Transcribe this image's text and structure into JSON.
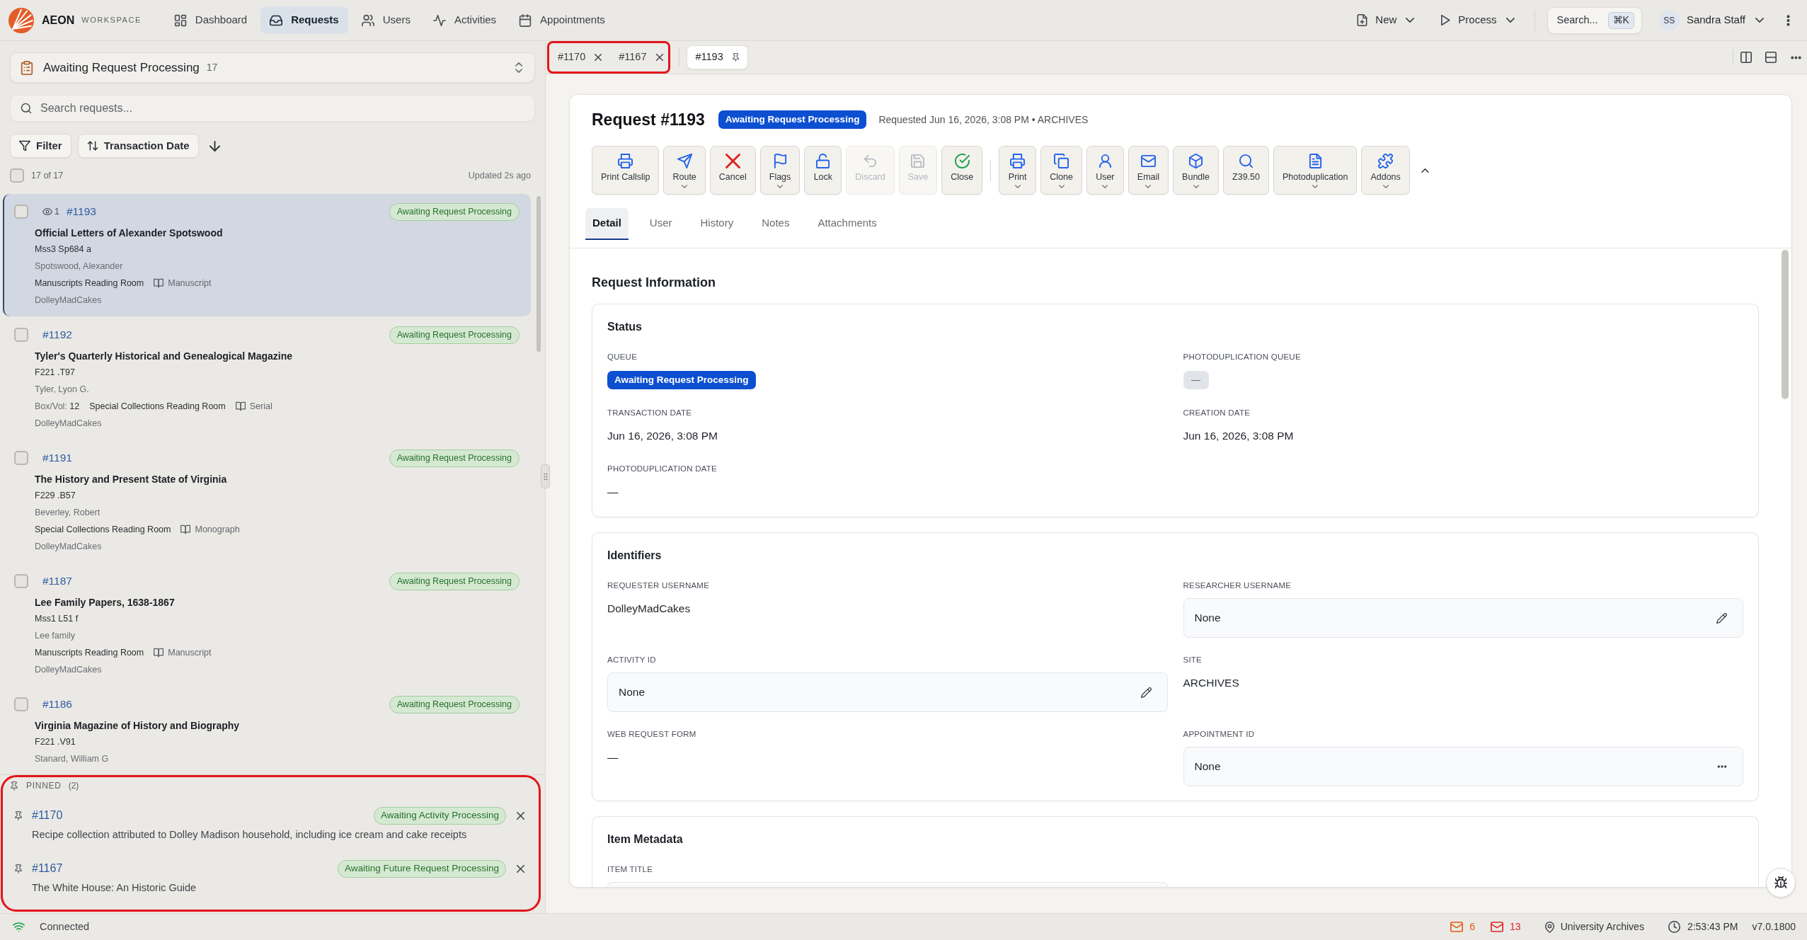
{
  "brand": {
    "name": "AEON",
    "subtitle": "WORKSPACE"
  },
  "nav": [
    {
      "label": "Dashboard",
      "selected": false
    },
    {
      "label": "Requests",
      "selected": true
    },
    {
      "label": "Users",
      "selected": false
    },
    {
      "label": "Activities",
      "selected": false
    },
    {
      "label": "Appointments",
      "selected": false
    }
  ],
  "header_actions": [
    {
      "label": "New"
    },
    {
      "label": "Process"
    }
  ],
  "global_search": {
    "placeholder": "Search...",
    "shortcut": "⌘K"
  },
  "user_menu": {
    "initials": "SS",
    "name": "Sandra Staff"
  },
  "queue_selector": {
    "label": "Awaiting Request Processing",
    "count": "17"
  },
  "request_search": {
    "placeholder": "Search requests..."
  },
  "filter_button": {
    "label": "Filter"
  },
  "sort_button": {
    "label": "Transaction Date"
  },
  "list_summary": {
    "checked": false,
    "count": "17 of 17",
    "updated": "Updated 2s ago"
  },
  "requests": [
    {
      "id": "#1193",
      "views": "1",
      "title": "Official Letters of Alexander Spotswood",
      "call_number": "Mss3 Sp684 a",
      "author": "Spotswood, Alexander",
      "location": "Manuscripts Reading Room",
      "format": "Manuscript",
      "user": "DolleyMadCakes",
      "status": "Awaiting Request Processing",
      "selected": true,
      "checked": false
    },
    {
      "id": "#1192",
      "title": "Tyler's Quarterly Historical and Genealogical Magazine",
      "call_number": "F221 .T97",
      "author": "Tyler, Lyon G.",
      "box_vol_label": "Box/Vol:",
      "box_vol": "12",
      "location": "Special Collections Reading Room",
      "format": "Serial",
      "user": "DolleyMadCakes",
      "status": "Awaiting Request Processing",
      "selected": false,
      "checked": false
    },
    {
      "id": "#1191",
      "title": "The History and Present State of Virginia",
      "call_number": "F229 .B57",
      "author": "Beverley, Robert",
      "location": "Special Collections Reading Room",
      "format": "Monograph",
      "user": "DolleyMadCakes",
      "status": "Awaiting Request Processing",
      "selected": false,
      "checked": false
    },
    {
      "id": "#1187",
      "title": "Lee Family Papers, 1638-1867",
      "call_number": "Mss1 L51 f",
      "author": "Lee family",
      "location": "Manuscripts Reading Room",
      "format": "Manuscript",
      "user": "DolleyMadCakes",
      "status": "Awaiting Request Processing",
      "selected": false,
      "checked": false
    },
    {
      "id": "#1186",
      "title": "Virginia Magazine of History and Biography",
      "call_number": "F221 .V91",
      "author": "Stanard, William G",
      "status": "Awaiting Request Processing",
      "selected": false,
      "checked": false
    }
  ],
  "pinned": {
    "label": "PINNED",
    "count": "(2)",
    "items": [
      {
        "id": "#1170",
        "status": "Awaiting Activity Processing",
        "title": "Recipe collection attributed to Dolley Madison household, including ice cream and cake receipts"
      },
      {
        "id": "#1167",
        "status": "Awaiting Future Request Processing",
        "title": "The White House: An Historic Guide"
      }
    ]
  },
  "open_tabs": [
    {
      "label": "#1170",
      "pinned": false,
      "selected": false
    },
    {
      "label": "#1167",
      "pinned": false,
      "selected": false
    },
    {
      "label": "#1193",
      "pinned": true,
      "selected": true
    }
  ],
  "request": {
    "title": "Request #1193",
    "status": "Awaiting Request Processing",
    "meta": "Requested Jun 16, 2026, 3:08 PM • ARCHIVES"
  },
  "toolbar": [
    {
      "buttons": [
        {
          "label": "Print Callslip",
          "dropdown": false,
          "disabled": false
        },
        {
          "label": "Route",
          "dropdown": true,
          "disabled": false
        },
        {
          "label": "Cancel",
          "dropdown": false,
          "disabled": false
        },
        {
          "label": "Flags",
          "dropdown": true,
          "disabled": false
        },
        {
          "label": "Lock",
          "dropdown": false,
          "disabled": false
        },
        {
          "label": "Discard",
          "dropdown": false,
          "disabled": true
        },
        {
          "label": "Save",
          "dropdown": false,
          "disabled": true
        },
        {
          "label": "Close",
          "dropdown": false,
          "disabled": false
        }
      ]
    },
    {
      "buttons": [
        {
          "label": "Print",
          "dropdown": true,
          "disabled": false
        },
        {
          "label": "Clone",
          "dropdown": true,
          "disabled": false
        },
        {
          "label": "User",
          "dropdown": true,
          "disabled": false
        },
        {
          "label": "Email",
          "dropdown": true,
          "disabled": false
        },
        {
          "label": "Bundle",
          "dropdown": true,
          "disabled": false
        },
        {
          "label": "Z39.50",
          "dropdown": false,
          "disabled": false
        },
        {
          "label": "Photoduplication",
          "dropdown": true,
          "disabled": false
        },
        {
          "label": "Addons",
          "dropdown": true,
          "disabled": false
        }
      ]
    }
  ],
  "detail_tabs": [
    {
      "label": "Detail",
      "selected": true
    },
    {
      "label": "User",
      "selected": false
    },
    {
      "label": "History",
      "selected": false
    },
    {
      "label": "Notes",
      "selected": false
    },
    {
      "label": "Attachments",
      "selected": false
    }
  ],
  "section_title": "Request Information",
  "cards": [
    {
      "title": "Status",
      "fields": [
        {
          "label": "QUEUE",
          "kind": "badge",
          "value": "Awaiting Request Processing"
        },
        {
          "label": "PHOTODUPLICATION QUEUE",
          "kind": "chip",
          "value": "—"
        },
        {
          "label": "TRANSACTION DATE",
          "kind": "text",
          "value": "Jun 16, 2026, 3:08 PM"
        },
        {
          "label": "CREATION DATE",
          "kind": "text",
          "value": "Jun 16, 2026, 3:08 PM"
        },
        {
          "label": "PHOTODUPLICATION DATE",
          "kind": "text",
          "value": "—"
        }
      ]
    },
    {
      "title": "Identifiers",
      "fields": [
        {
          "label": "REQUESTER USERNAME",
          "kind": "text",
          "value": "DolleyMadCakes"
        },
        {
          "label": "RESEARCHER USERNAME",
          "kind": "editable",
          "value": "None"
        },
        {
          "label": "ACTIVITY ID",
          "kind": "editable",
          "value": "None"
        },
        {
          "label": "SITE",
          "kind": "text",
          "value": "ARCHIVES"
        },
        {
          "label": "WEB REQUEST FORM",
          "kind": "text",
          "value": "—"
        },
        {
          "label": "APPOINTMENT ID",
          "kind": "lookup",
          "value": "None"
        }
      ]
    },
    {
      "title": "Item Metadata",
      "fields": [
        {
          "label": "ITEM TITLE",
          "kind": "editable"
        }
      ]
    }
  ],
  "status_bar": {
    "connection": "Connected",
    "mail_counts": [
      {
        "count": "6",
        "color": "#e8590c"
      },
      {
        "count": "13",
        "color": "#dc2626"
      }
    ],
    "location": "University Archives",
    "time": "2:53:43 PM",
    "version": "v7.0.1800"
  }
}
